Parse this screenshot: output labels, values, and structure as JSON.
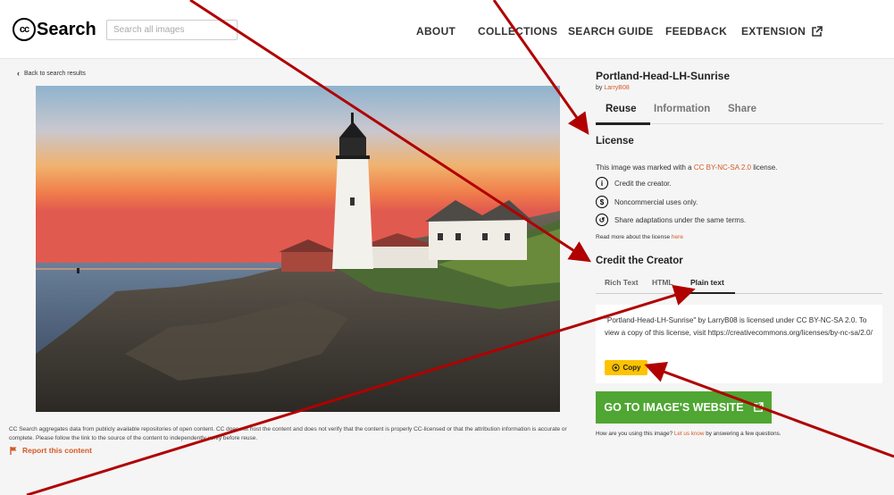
{
  "header": {
    "logo_cc": "cc",
    "logo_text": "Search",
    "search_placeholder": "Search all images",
    "nav": [
      "ABOUT",
      "COLLECTIONS",
      "SEARCH GUIDE",
      "FEEDBACK",
      "EXTENSION"
    ]
  },
  "back_link": "Back to search results",
  "disclaimer": "CC Search aggregates data from publicly available repositories of open content. CC does not host the content and does not verify that the content is properly CC-licensed or that the attribution information is accurate or complete. Please follow the link to the source of the content to independently verify before reuse.",
  "report": "Report this content",
  "image": {
    "title": "Portland-Head-LH-Sunrise",
    "by": "by",
    "author": "LarryB08"
  },
  "tabs": [
    "Reuse",
    "Information",
    "Share"
  ],
  "license": {
    "heading": "License",
    "line_prefix": "This image was marked with a",
    "license_name": "CC BY-NC-SA 2.0",
    "line_suffix": "license.",
    "items": [
      "Credit the creator.",
      "Noncommercial uses only.",
      "Share adaptations under the same terms."
    ],
    "read_more_prefix": "Read more about the license",
    "read_more_link": "here"
  },
  "credit": {
    "heading": "Credit the Creator",
    "subtabs": [
      "Rich Text",
      "HTML",
      "Plain text"
    ],
    "attribution": "\"Portland-Head-LH-Sunrise\" by LarryB08 is licensed under CC BY-NC-SA 2.0. To view a copy of this license, visit https://creativecommons.org/licenses/by-nc-sa/2.0/",
    "copy": "Copy"
  },
  "website_button": "GO TO IMAGE'S WEBSITE",
  "feedback": {
    "prefix": "How are you using this image?",
    "link": "Let us know",
    "suffix": "by answering a few questions."
  },
  "colors": {
    "accent": "#d35a28",
    "copy_button": "#fdc300",
    "website_button": "#4fa632",
    "annotation_arrow": "#b00000"
  }
}
